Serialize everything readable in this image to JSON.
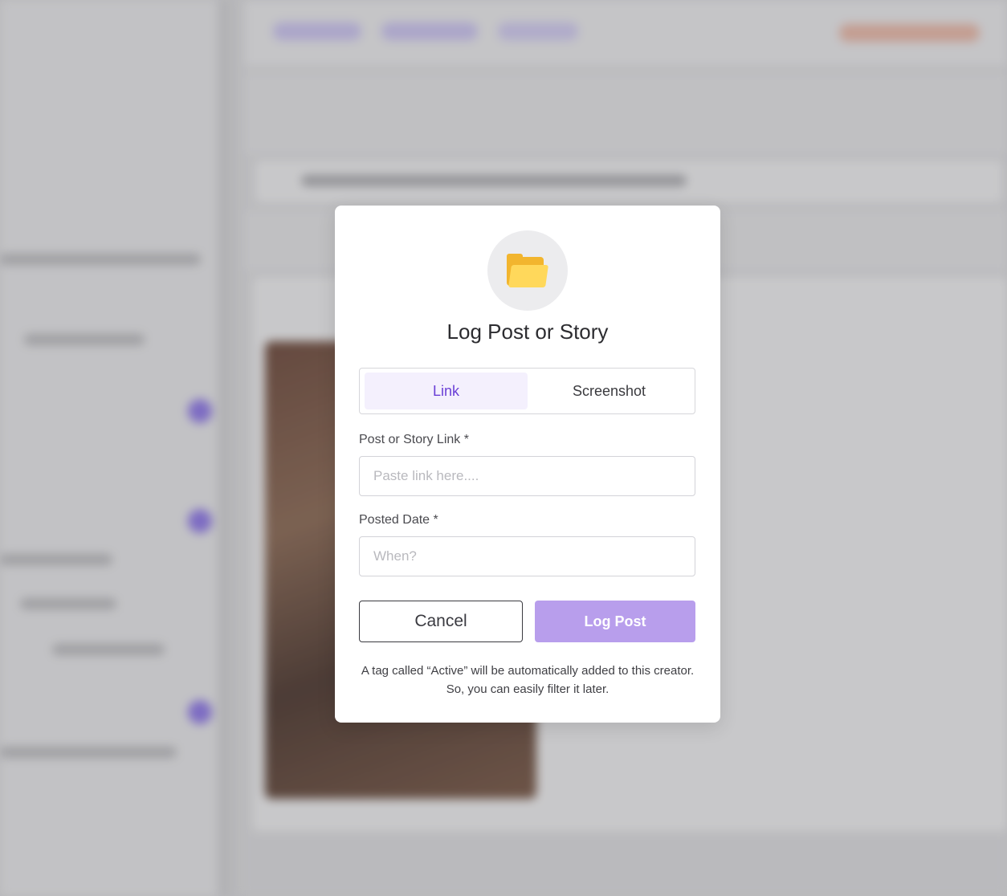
{
  "modal": {
    "icon": "folder-icon",
    "title": "Log Post or Story",
    "tabs": [
      {
        "label": "Link",
        "active": true
      },
      {
        "label": "Screenshot",
        "active": false
      }
    ],
    "link_field": {
      "label": "Post or Story Link *",
      "placeholder": "Paste link here...."
    },
    "date_field": {
      "label": "Posted Date *",
      "placeholder": "When?"
    },
    "cancel_label": "Cancel",
    "submit_label": "Log Post",
    "note": "A tag called “Active” will be automatically added to this creator. So, you can easily filter it later."
  },
  "colors": {
    "accent": "#6a3fd6",
    "active_tab_bg": "#f4f0fd",
    "submit_bg": "#b89eec",
    "folder_back": "#f2b52e",
    "folder_front": "#ffd85b"
  }
}
